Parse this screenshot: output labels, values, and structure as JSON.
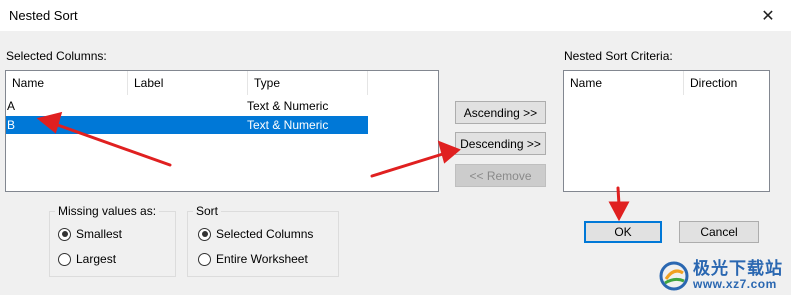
{
  "window": {
    "title": "Nested Sort",
    "close_glyph": "✕"
  },
  "selected_columns": {
    "label": "Selected Columns:",
    "headers": [
      "Name",
      "Label",
      "Type"
    ],
    "rows": [
      {
        "name": "A",
        "label": "",
        "type": "Text & Numeric",
        "selected": false
      },
      {
        "name": "B",
        "label": "",
        "type": "Text & Numeric",
        "selected": true
      }
    ]
  },
  "buttons": {
    "ascending": "Ascending >>",
    "descending": "Descending >>",
    "remove": "<< Remove",
    "ok": "OK",
    "cancel": "Cancel"
  },
  "nested_sort_criteria": {
    "label": "Nested Sort Criteria:",
    "headers": [
      "Name",
      "Direction"
    ]
  },
  "missing_values": {
    "title": "Missing values as:",
    "options": [
      "Smallest",
      "Largest"
    ],
    "selected": "Smallest"
  },
  "sort": {
    "title": "Sort",
    "options": [
      "Selected Columns",
      "Entire Worksheet"
    ],
    "selected": "Selected Columns"
  },
  "watermark": {
    "text": "极光下载站",
    "url": "www.xz7.com"
  },
  "colors": {
    "selection": "#0078d7",
    "annotation_arrow": "#e02020",
    "watermark": "#2a67b1"
  }
}
